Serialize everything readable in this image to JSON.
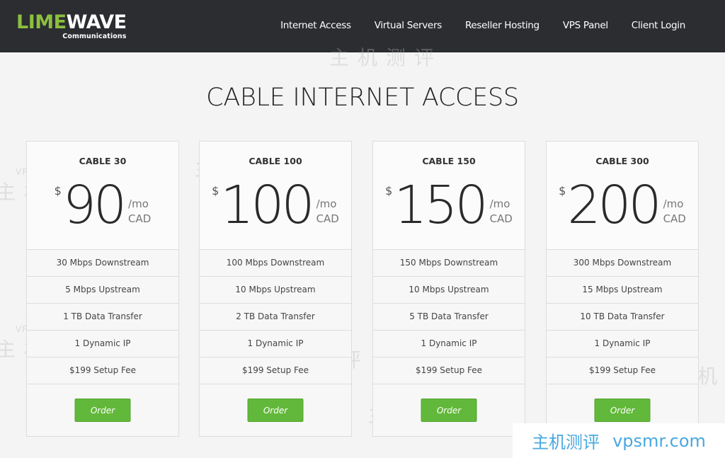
{
  "header": {
    "logo": {
      "part1": "LIME",
      "part2": "WAVE",
      "subtitle": "Communications"
    },
    "nav": [
      {
        "label": "Internet Access"
      },
      {
        "label": "Virtual Servers"
      },
      {
        "label": "Reseller Hosting"
      },
      {
        "label": "VPS Panel"
      },
      {
        "label": "Client Login"
      }
    ]
  },
  "main": {
    "title": "CABLE INTERNET ACCESS",
    "plans": [
      {
        "name": "CABLE 30",
        "currency": "$",
        "price": "90",
        "period": "/mo",
        "currency_code": "CAD",
        "features": [
          "30 Mbps Downstream",
          "5 Mbps Upstream",
          "1 TB Data Transfer",
          "1 Dynamic IP",
          "$199 Setup Fee"
        ],
        "order_label": "Order"
      },
      {
        "name": "CABLE 100",
        "currency": "$",
        "price": "100",
        "period": "/mo",
        "currency_code": "CAD",
        "features": [
          "100 Mbps Downstream",
          "10 Mbps Upstream",
          "2 TB Data Transfer",
          "1 Dynamic IP",
          "$199 Setup Fee"
        ],
        "order_label": "Order"
      },
      {
        "name": "CABLE 150",
        "currency": "$",
        "price": "150",
        "period": "/mo",
        "currency_code": "CAD",
        "features": [
          "150 Mbps Downstream",
          "10 Mbps Upstream",
          "5 TB Data Transfer",
          "1 Dynamic IP",
          "$199 Setup Fee"
        ],
        "order_label": "Order"
      },
      {
        "name": "CABLE 300",
        "currency": "$",
        "price": "200",
        "period": "/mo",
        "currency_code": "CAD",
        "features": [
          "300 Mbps Downstream",
          "15 Mbps Upstream",
          "10 TB Data Transfer",
          "1 Dynamic IP",
          "$199 Setup Fee"
        ],
        "order_label": "Order"
      }
    ]
  },
  "watermark": {
    "cn": "主机测评",
    "domain": "VPSMR.COM",
    "footer_cn": "主机测评",
    "footer_url": "vpsmr.com"
  },
  "colors": {
    "header_bg": "#2b2d31",
    "logo_accent": "#8cbf3f",
    "order_button": "#62b83a",
    "watermark_blue": "#4aa8e0"
  }
}
